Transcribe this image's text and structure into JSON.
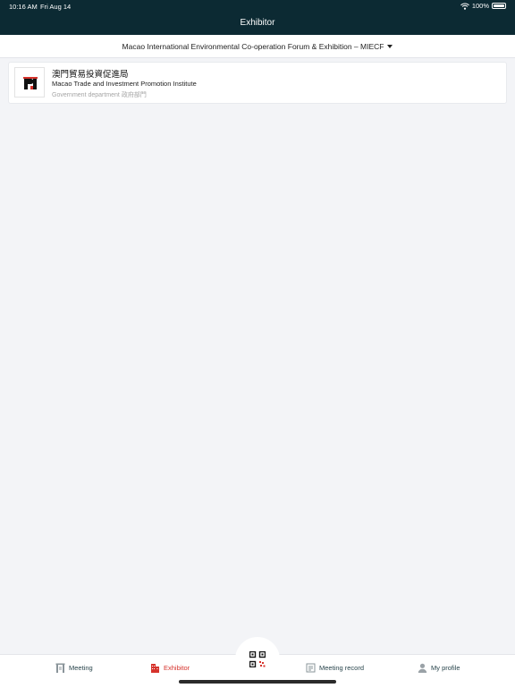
{
  "status": {
    "time": "10:16 AM",
    "date": "Fri Aug 14",
    "battery": "100%"
  },
  "header": {
    "title": "Exhibitor"
  },
  "event_selector": {
    "selected": "Macao International Environmental Co-operation Forum & Exhibition – MIECF"
  },
  "exhibitors": [
    {
      "name_zh": "澳門貿易投資促進局",
      "name_en": "Macao Trade and Investment Promotion Institute",
      "category": "Government department 政府部門",
      "logo_icon": "ipim-logo"
    }
  ],
  "tabs": [
    {
      "label": "Meeting",
      "icon": "meeting-icon"
    },
    {
      "label": "Exhibitor",
      "icon": "building-icon"
    },
    {
      "label": "Meeting record",
      "icon": "record-icon"
    },
    {
      "label": "My profile",
      "icon": "person-icon"
    }
  ],
  "colors": {
    "header_bg": "#0c2a33",
    "active_tab": "#d6332c",
    "tab_text": "#29454c",
    "background": "#f3f4f7"
  }
}
